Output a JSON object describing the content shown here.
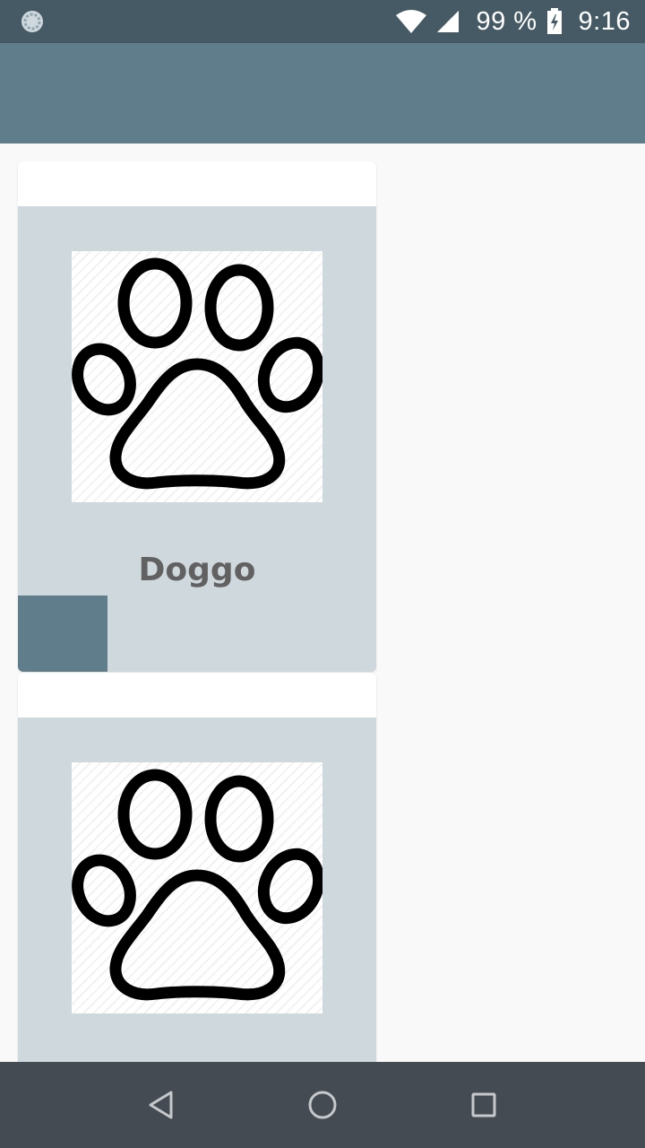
{
  "status_bar": {
    "battery_percent": "99 %",
    "time": "9:16",
    "icons": [
      "loading-spinner-icon",
      "wifi-icon",
      "signal-icon",
      "battery-charging-icon"
    ]
  },
  "cards": [
    {
      "title": "Doggo",
      "image_icon": "paw-print-icon"
    },
    {
      "title": "",
      "image_icon": "paw-print-icon"
    }
  ],
  "nav_bar": {
    "icons": [
      "back-triangle-icon",
      "home-circle-icon",
      "recents-square-icon"
    ]
  },
  "colors": {
    "status_bar": "#455a64",
    "app_bar": "#607d8b",
    "card_background": "#cfd8dc",
    "card_title": "#616161",
    "nav_bar": "#444b52"
  }
}
